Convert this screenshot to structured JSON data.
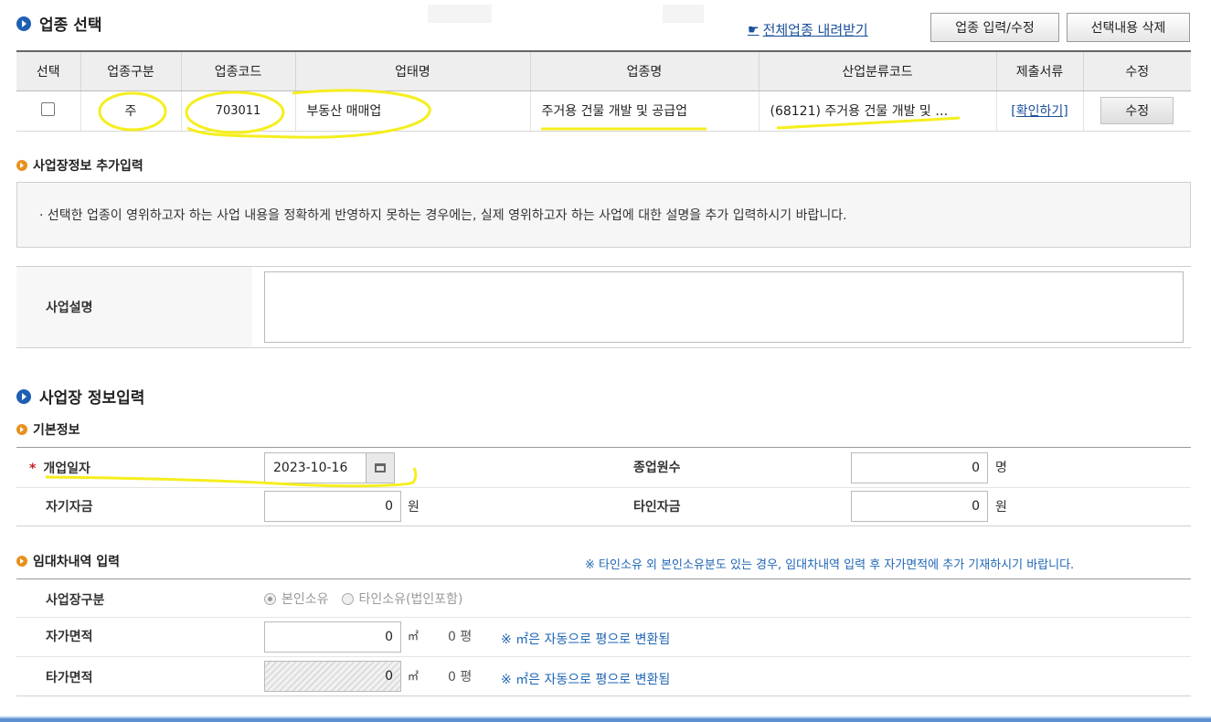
{
  "industry": {
    "title": "업종 선택",
    "download_link": "전체업종 내려받기",
    "btn_edit": "업종 입력/수정",
    "btn_delete": "선택내용 삭제",
    "columns": [
      "선택",
      "업종구분",
      "업종코드",
      "업태명",
      "업종명",
      "산업분류코드",
      "제출서류",
      "수정"
    ],
    "row": {
      "type": "주",
      "code": "703011",
      "business": "부동산 매매업",
      "industry_name": "주거용 건물 개발 및 공급업",
      "class_code": "(68121) 주거용 건물 개발 및 …",
      "docs_link": "[확인하기]",
      "edit_btn": "수정"
    }
  },
  "addinfo": {
    "title": "사업장정보 추가입력",
    "notice": "· 선택한 업종이 영위하고자 하는 사업 내용을 정확하게 반영하지 못하는 경우에는, 실제 영위하고자 하는 사업에 대한 설명을 추가 입력하시기 바랍니다.",
    "desc_label": "사업설명"
  },
  "site": {
    "title": "사업장 정보입력",
    "basic_title": "기본정보",
    "open_date_label": "개업일자",
    "open_date_value": "2023-10-16",
    "employees_label": "종업원수",
    "employees_value": "0",
    "employees_unit": "명",
    "own_capital_label": "자기자금",
    "own_capital_value": "0",
    "own_capital_unit": "원",
    "other_capital_label": "타인자금",
    "other_capital_value": "0",
    "other_capital_unit": "원"
  },
  "lease": {
    "title": "임대차내역 입력",
    "notice": "※ 타인소유 외 본인소유분도 있는 경우, 임대차내역 입력 후 자가면적에 추가 기재하시기 바랍니다.",
    "type_label": "사업장구분",
    "opt_own": "본인소유",
    "opt_other": "타인소유(법인포함)",
    "own_area_label": "자가면적",
    "own_area_value": "0",
    "other_area_label": "타가면적",
    "other_area_value": "0",
    "area_unit": "㎡",
    "pyeong_value": "0 평",
    "conv_hint": "※ ㎡은 자동으로 평으로 변환됨"
  }
}
